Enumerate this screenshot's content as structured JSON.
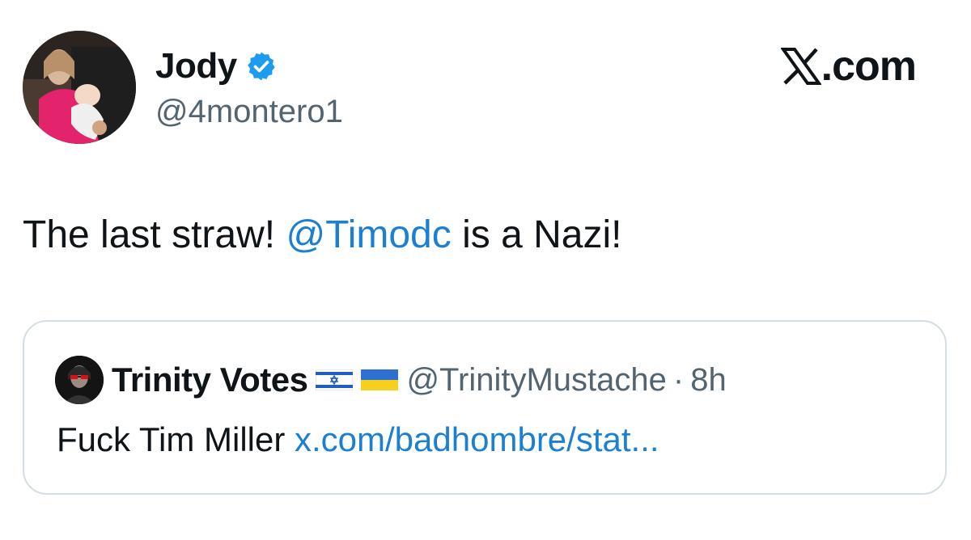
{
  "author": {
    "display_name": "Jody",
    "handle": "@4montero1",
    "verified": true,
    "avatar_icon": "profile-photo-avatar",
    "verified_icon": "verified-badge-icon",
    "verified_color": "#1d9bf0"
  },
  "brand": {
    "logo_icon": "x-logo-icon",
    "domain": ".com"
  },
  "tweet": {
    "text_before": "The last straw! ",
    "mention": "@Timodc",
    "text_after": " is a Nazi!"
  },
  "quoted_tweet": {
    "display_name": "Trinity Votes",
    "flags": [
      "israel-flag-icon",
      "ukraine-flag-icon"
    ],
    "handle": "@TrinityMustache",
    "separator": "·",
    "time": "8h",
    "text": "Fuck Tim Miller ",
    "link": "x.com/badhombre/stat..."
  },
  "colors": {
    "link": "#1d7fd1",
    "secondary_text": "#536471",
    "border": "#d6dde3"
  }
}
